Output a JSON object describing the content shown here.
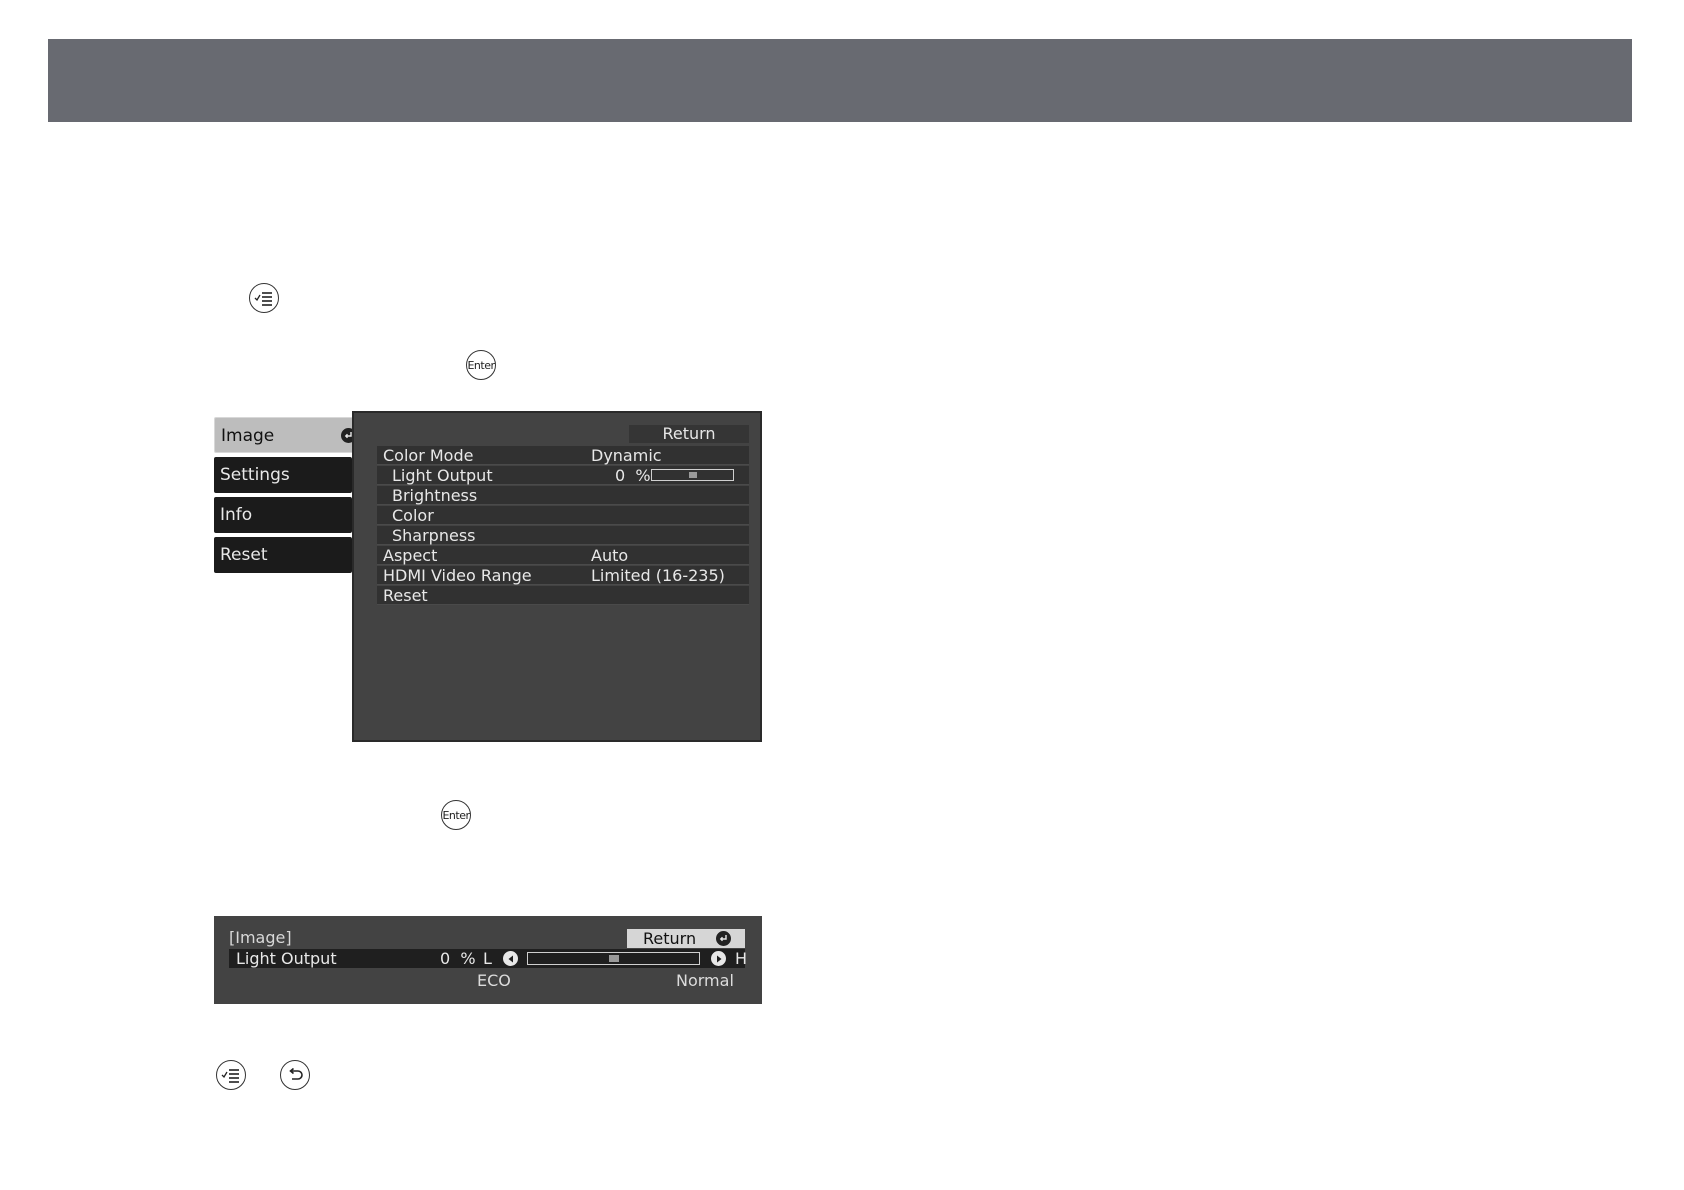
{
  "menu": {
    "tabs": [
      {
        "label": "Image",
        "active": true
      },
      {
        "label": "Settings",
        "active": false
      },
      {
        "label": "Info",
        "active": false
      },
      {
        "label": "Reset",
        "active": false
      }
    ],
    "return_label": "Return",
    "rows": [
      {
        "label": "Color Mode",
        "value": "Dynamic"
      },
      {
        "label": "Light Output",
        "value": "0",
        "unit": "%",
        "level_percent": 50
      },
      {
        "label": "Brightness",
        "value": ""
      },
      {
        "label": "Color",
        "value": ""
      },
      {
        "label": "Sharpness",
        "value": ""
      },
      {
        "label": "Aspect",
        "value": "Auto"
      },
      {
        "label": "HDMI Video Range",
        "value": "Limited (16-235)"
      },
      {
        "label": "Reset",
        "value": ""
      }
    ]
  },
  "adjust": {
    "title": "[Image]",
    "return_label": "Return",
    "row_label": "Light Output",
    "value": "0",
    "unit": "%",
    "low_label": "L",
    "high_label": "H",
    "level_percent": 50,
    "scale_low": "ECO",
    "scale_high": "Normal"
  },
  "buttons": {
    "enter_label": "Enter"
  },
  "icons": [
    "menu-list-icon",
    "enter-button-icon",
    "return-arrow-icon"
  ],
  "colors": {
    "header_bar": "#686a71",
    "osd_panel": "#434343",
    "osd_row": "#313131",
    "tab_active": "#bdbdbd"
  }
}
